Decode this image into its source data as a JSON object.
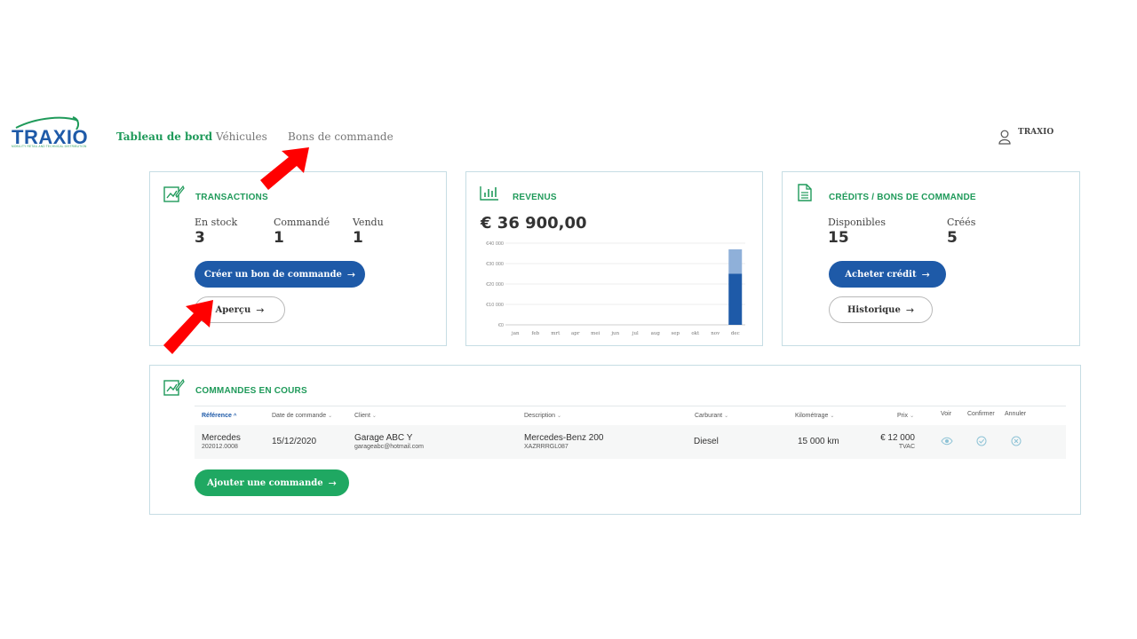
{
  "brand": {
    "name": "TRAXIO",
    "tagline": "MOBILITY RETAIL AND TECHNICAL DISTRIBUTION",
    "green": "#1f9a5a",
    "blue": "#1e5aa8"
  },
  "nav": {
    "items": [
      {
        "label": "Tableau de bord",
        "active": true
      },
      {
        "label": "Véhicules",
        "active": false
      },
      {
        "label": "Bons de commande",
        "active": false
      }
    ]
  },
  "user": {
    "name": "TRAXIO",
    "icon": "user-icon"
  },
  "transactions": {
    "title": "TRANSACTIONS",
    "icon": "chart-edit-icon",
    "stats": [
      {
        "label": "En stock",
        "value": "3"
      },
      {
        "label": "Commandé",
        "value": "1"
      },
      {
        "label": "Vendu",
        "value": "1"
      }
    ],
    "create_button": "Créer un bon de commande",
    "preview_button": "Aperçu"
  },
  "revenue": {
    "title": "REVENUS",
    "icon": "bar-chart-icon",
    "total": "€ 36 900,00"
  },
  "chart_data": {
    "type": "bar",
    "categories": [
      "jan",
      "feb",
      "mrt",
      "apr",
      "mei",
      "jun",
      "jul",
      "aug",
      "sep",
      "okt",
      "nov",
      "dec"
    ],
    "series": [
      {
        "values": [
          0,
          0,
          0,
          0,
          0,
          0,
          0,
          0,
          0,
          0,
          0,
          25000
        ],
        "color": "#1e5aa8"
      },
      {
        "values": [
          0,
          0,
          0,
          0,
          0,
          0,
          0,
          0,
          0,
          0,
          0,
          12000
        ],
        "color": "#8fb0d9"
      }
    ],
    "stacked": true,
    "y_ticks": [
      "€0",
      "€10 000",
      "€20 000",
      "€30 000",
      "€40 000"
    ],
    "ylim": [
      0,
      40000
    ],
    "grid": true
  },
  "credits": {
    "title": "CRÉDITS / BONS DE COMMANDE",
    "icon": "document-icon",
    "stats": [
      {
        "label": "Disponibles",
        "value": "15"
      },
      {
        "label": "Créés",
        "value": "5"
      }
    ],
    "buy_button": "Acheter crédit",
    "history_button": "Historique"
  },
  "orders": {
    "title": "COMMANDES EN COURS",
    "icon": "chart-edit-icon",
    "columns": [
      "Référence",
      "Date de commande",
      "Client",
      "Description",
      "Carburant",
      "Kilométrage",
      "Prix",
      "Voir",
      "Confirmer",
      "Annuler"
    ],
    "rows": [
      {
        "brand": "Mercedes",
        "reference": "202012.0008",
        "date": "15/12/2020",
        "client": "Garage ABC Y",
        "email": "garageabc@hotmail.com",
        "model": "Mercedes-Benz 200",
        "vin": "XAZRRRGL087",
        "fuel": "Diesel",
        "mileage": "15 000 km",
        "price": "€ 12 000",
        "price_note": "TVAC"
      }
    ],
    "add_button": "Ajouter une commande"
  },
  "annotations": {
    "arrow_color": "#ff0000"
  }
}
